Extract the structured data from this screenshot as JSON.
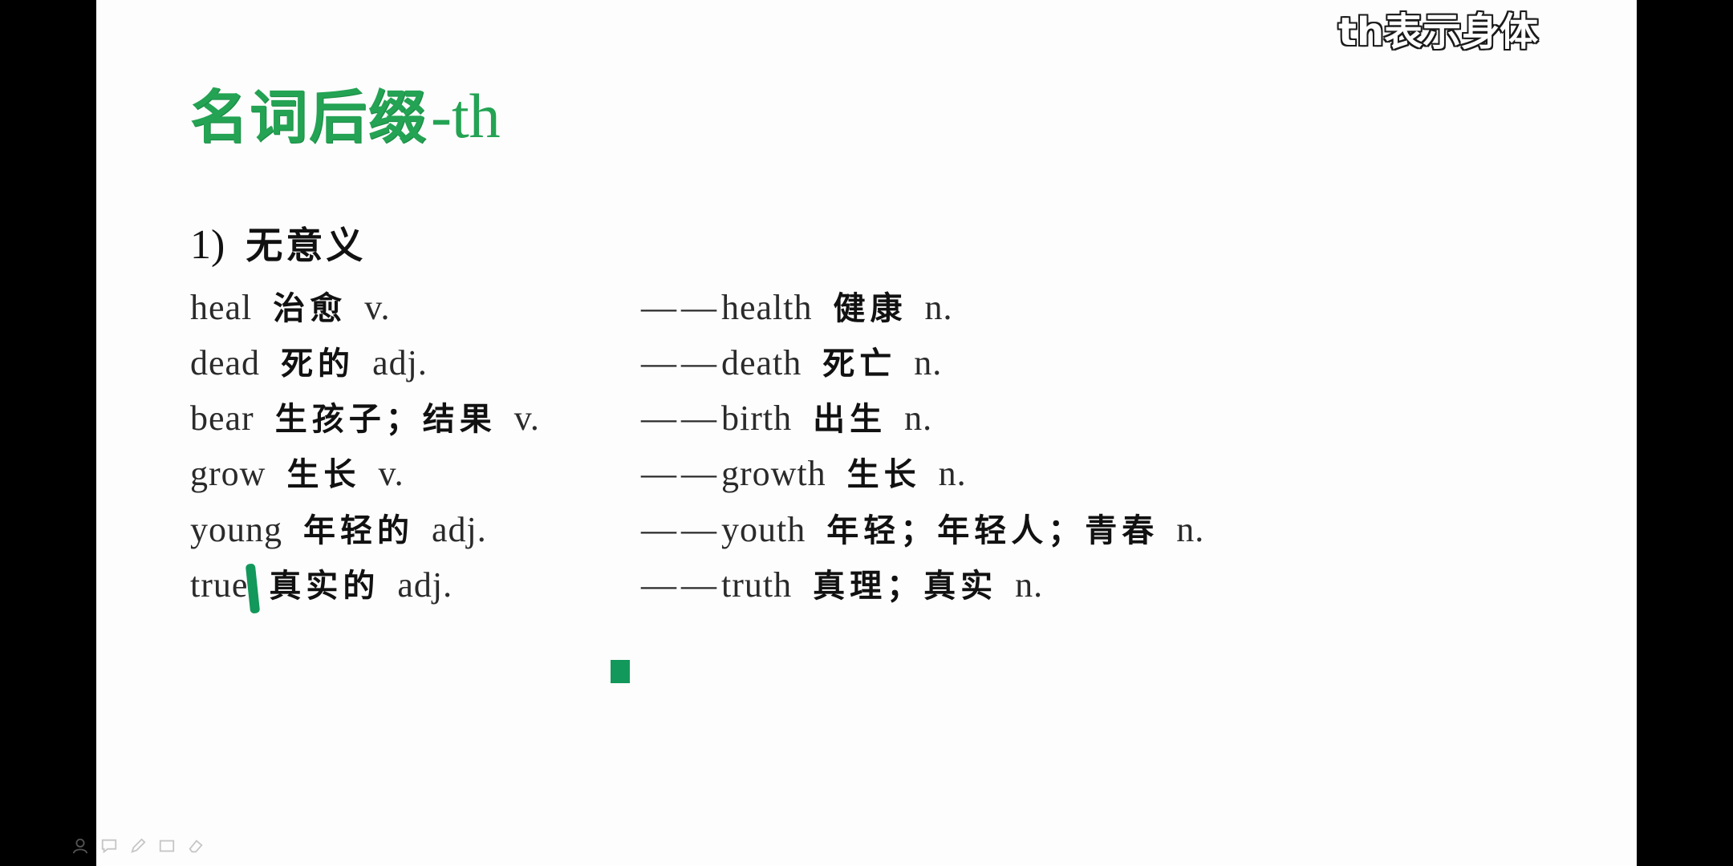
{
  "caption": "th表示身体",
  "title": {
    "main": "名词后缀",
    "suffix": "-th"
  },
  "section": {
    "number": "1)",
    "label": "无意义"
  },
  "rows": [
    {
      "word": "heal",
      "meaning": "治愈",
      "pos": "v.",
      "dash": "——",
      "derived": "health",
      "derived_meaning": "健康",
      "derived_pos": "n."
    },
    {
      "word": "dead",
      "meaning": "死的",
      "pos": "adj.",
      "dash": "——",
      "derived": "death",
      "derived_meaning": "死亡",
      "derived_pos": "n."
    },
    {
      "word": "bear",
      "meaning": "生孩子；结果",
      "pos": "v.",
      "dash": "——",
      "derived": "birth",
      "derived_meaning": "出生",
      "derived_pos": "n."
    },
    {
      "word": "grow",
      "meaning": "生长",
      "pos": "v.",
      "dash": "——",
      "derived": "growth",
      "derived_meaning": "生长",
      "derived_pos": "n."
    },
    {
      "word": "young",
      "meaning": "年轻的",
      "pos": "adj.",
      "dash": "——",
      "derived": "youth",
      "derived_meaning": "年轻；年轻人；青春",
      "derived_pos": "n."
    },
    {
      "word": "true",
      "meaning": "真实的",
      "pos": "adj.",
      "dash": "——",
      "derived": "truth",
      "derived_meaning": "真理；真实",
      "derived_pos": "n."
    }
  ],
  "toolbar": {
    "icons": [
      "person-icon",
      "chat-icon",
      "pen-icon",
      "rectangle-icon",
      "eraser-icon"
    ]
  },
  "colors": {
    "title_green": "#23a353",
    "annotation_green": "#12985a",
    "slide_background": "#fdfdfd",
    "letterbox": "#000000"
  }
}
